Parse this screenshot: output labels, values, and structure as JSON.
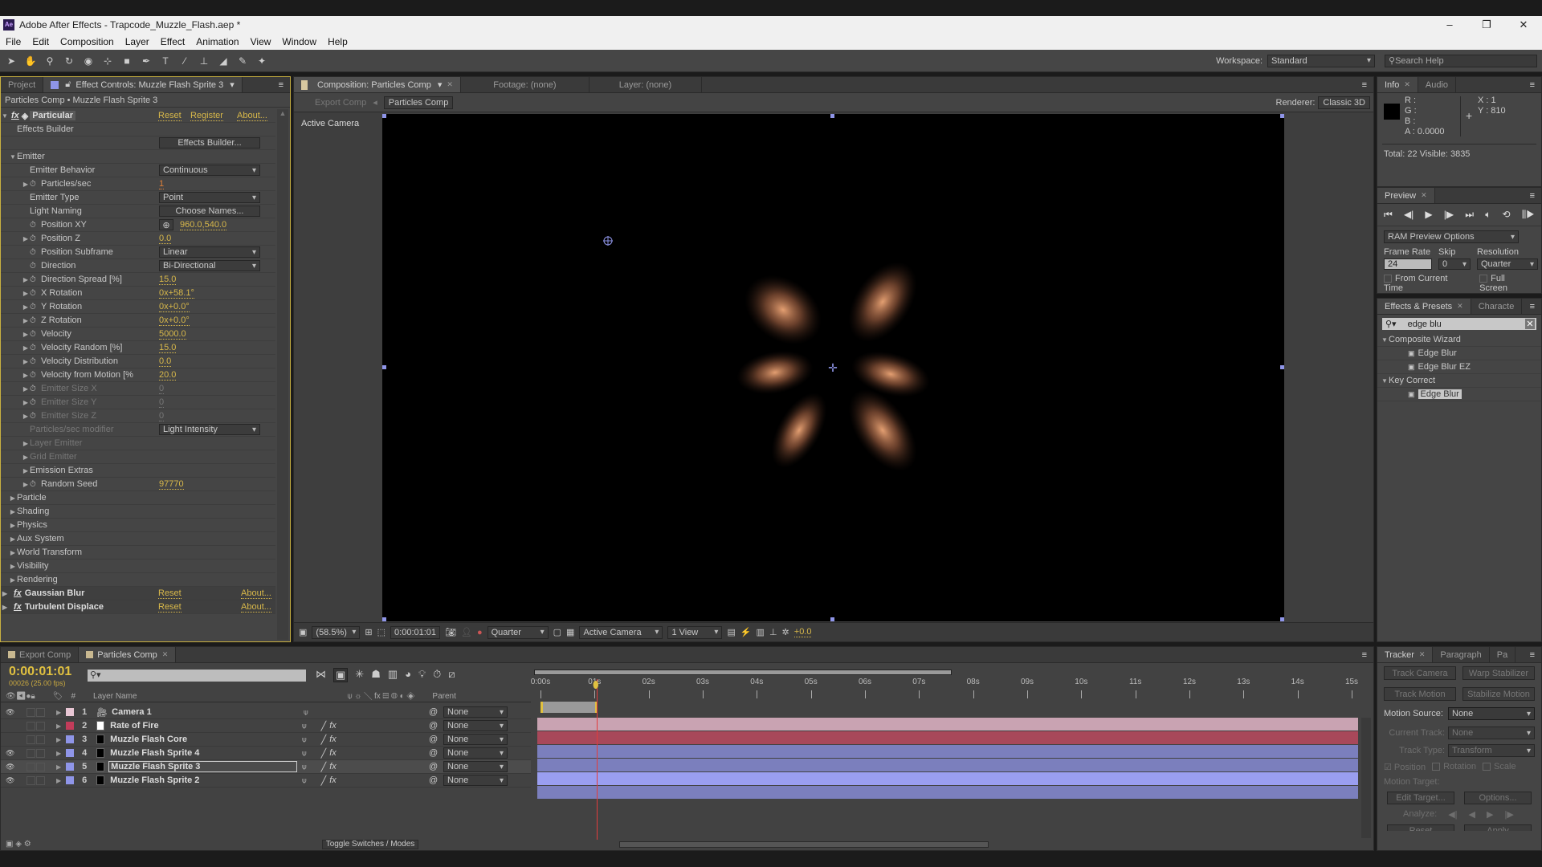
{
  "window": {
    "title": "Adobe After Effects - Trapcode_Muzzle_Flash.aep *",
    "min": "–",
    "max": "❐",
    "close": "✕"
  },
  "menu": [
    "File",
    "Edit",
    "Composition",
    "Layer",
    "Effect",
    "Animation",
    "View",
    "Window",
    "Help"
  ],
  "toolbar": {
    "workspace_label": "Workspace:",
    "workspace": "Standard",
    "search_placeholder": "Search Help"
  },
  "left_panel": {
    "tabs": [
      "Project",
      "Effect Controls: Muzzle Flash Sprite 3"
    ],
    "breadcrumb": "Particles Comp • Muzzle Flash Sprite 3",
    "effect": {
      "name": "Particular",
      "reset": "Reset",
      "register": "Register",
      "about": "About..."
    },
    "rows": [
      {
        "label": "Effects Builder",
        "indent": 1
      },
      {
        "label": "",
        "button": "Effects Builder...",
        "indent": 1
      },
      {
        "label": "Emitter",
        "indent": 1,
        "tri": "open"
      },
      {
        "label": "Emitter Behavior",
        "indent": 2,
        "dropdown": "Continuous"
      },
      {
        "label": "Particles/sec",
        "indent": 2,
        "tri": "closed",
        "sw": true,
        "value": "1",
        "orange": true
      },
      {
        "label": "Emitter Type",
        "indent": 2,
        "dropdown": "Point"
      },
      {
        "label": "Light Naming",
        "indent": 2,
        "button": "Choose Names..."
      },
      {
        "label": "Position XY",
        "indent": 2,
        "sw": true,
        "value": "960.0,540.0",
        "target": true
      },
      {
        "label": "Position Z",
        "indent": 2,
        "tri": "closed",
        "sw": true,
        "value": "0.0"
      },
      {
        "label": "Position Subframe",
        "indent": 2,
        "sw": true,
        "dropdown": "Linear"
      },
      {
        "label": "Direction",
        "indent": 2,
        "sw": true,
        "dropdown": "Bi-Directional"
      },
      {
        "label": "Direction Spread [%]",
        "indent": 2,
        "tri": "closed",
        "sw": true,
        "value": "15.0"
      },
      {
        "label": "X Rotation",
        "indent": 2,
        "tri": "closed",
        "sw": true,
        "value": "0x+58.1°"
      },
      {
        "label": "Y Rotation",
        "indent": 2,
        "tri": "closed",
        "sw": true,
        "value": "0x+0.0°"
      },
      {
        "label": "Z Rotation",
        "indent": 2,
        "tri": "closed",
        "sw": true,
        "value": "0x+0.0°"
      },
      {
        "label": "Velocity",
        "indent": 2,
        "tri": "closed",
        "sw": true,
        "value": "5000.0"
      },
      {
        "label": "Velocity Random [%]",
        "indent": 2,
        "tri": "closed",
        "sw": true,
        "value": "15.0"
      },
      {
        "label": "Velocity Distribution",
        "indent": 2,
        "tri": "closed",
        "sw": true,
        "value": "0.0"
      },
      {
        "label": "Velocity from Motion [%",
        "indent": 2,
        "tri": "closed",
        "sw": true,
        "value": "20.0"
      },
      {
        "label": "Emitter Size X",
        "indent": 2,
        "tri": "closed",
        "sw": true,
        "value": "0",
        "disabled": true
      },
      {
        "label": "Emitter Size Y",
        "indent": 2,
        "tri": "closed",
        "sw": true,
        "value": "0",
        "disabled": true
      },
      {
        "label": "Emitter Size Z",
        "indent": 2,
        "tri": "closed",
        "sw": true,
        "value": "0",
        "disabled": true
      },
      {
        "label": "Particles/sec modifier",
        "indent": 2,
        "dropdown": "Light Intensity",
        "disabled": true
      },
      {
        "label": "Layer Emitter",
        "indent": 2,
        "tri": "closed",
        "disabled": true
      },
      {
        "label": "Grid Emitter",
        "indent": 2,
        "tri": "closed",
        "disabled": true
      },
      {
        "label": "Emission Extras",
        "indent": 2,
        "tri": "closed"
      },
      {
        "label": "Random Seed",
        "indent": 2,
        "tri": "closed",
        "sw": true,
        "value": "97770"
      },
      {
        "label": "Particle",
        "indent": 1,
        "tri": "closed"
      },
      {
        "label": "Shading",
        "indent": 1,
        "tri": "closed"
      },
      {
        "label": "Physics",
        "indent": 1,
        "tri": "closed"
      },
      {
        "label": "Aux System",
        "indent": 1,
        "tri": "closed"
      },
      {
        "label": "World Transform",
        "indent": 1,
        "tri": "closed"
      },
      {
        "label": "Visibility",
        "indent": 1,
        "tri": "closed"
      },
      {
        "label": "Rendering",
        "indent": 1,
        "tri": "closed"
      }
    ],
    "other_effects": [
      {
        "name": "Gaussian Blur",
        "reset": "Reset",
        "about": "About..."
      },
      {
        "name": "Turbulent Displace",
        "reset": "Reset",
        "about": "About..."
      }
    ]
  },
  "viewer": {
    "tabs": [
      "Composition: Particles Comp",
      "Footage: (none)",
      "Layer: (none)"
    ],
    "crumbs": [
      "Export Comp",
      "Particles Comp"
    ],
    "renderer_label": "Renderer:",
    "renderer": "Classic 3D",
    "camera_label": "Active Camera",
    "bottom": {
      "zoom": "(58.5%)",
      "time": "0:00:01:01",
      "resolution": "Quarter",
      "view": "Active Camera",
      "layout": "1 View",
      "exposure": "+0.0"
    }
  },
  "info": {
    "tabs": [
      "Info",
      "Audio"
    ],
    "r": "R :",
    "g": "G :",
    "b": "B :",
    "a": "A : 0.0000",
    "x": "X : 1",
    "y": "Y : 810",
    "totals": "Total: 22   Visible: 3835"
  },
  "preview": {
    "tab": "Preview",
    "ram": "RAM Preview Options",
    "frame_rate_label": "Frame Rate",
    "skip_label": "Skip",
    "resolution_label": "Resolution",
    "frame_rate": "24",
    "skip": "0",
    "resolution": "Quarter",
    "from_current": "From Current Time",
    "full_screen": "Full Screen"
  },
  "effects_presets": {
    "tabs": [
      "Effects & Presets",
      "Characte"
    ],
    "search": "edge blu",
    "groups": [
      {
        "name": "Composite Wizard",
        "items": [
          "Edge Blur",
          "Edge Blur EZ"
        ]
      },
      {
        "name": "Key Correct",
        "items": [
          "Edge Blur"
        ]
      }
    ]
  },
  "timeline": {
    "tabs": [
      "Export Comp",
      "Particles Comp"
    ],
    "timecode": "0:00:01:01",
    "frames": "00026 (25.00 fps)",
    "headers": {
      "num": "#",
      "name": "Layer Name",
      "parent": "Parent"
    },
    "ruler": [
      "0:00s",
      "01s",
      "02s",
      "03s",
      "04s",
      "05s",
      "06s",
      "07s",
      "08s",
      "09s",
      "10s",
      "11s",
      "12s",
      "13s",
      "14s",
      "15s"
    ],
    "playhead_seconds": 1.04,
    "work_area_end_seconds": 7.6,
    "layers": [
      {
        "num": "1",
        "name": "Camera 1",
        "label_color": "#e8c6d4",
        "bar_color": "#c9a3b2",
        "visible": true,
        "camera": true,
        "parent": "None"
      },
      {
        "num": "2",
        "name": "Rate of Fire",
        "label_color": "#c23c5a",
        "bar_color": "#a8485a",
        "visible": false,
        "swatch": "#ffffff",
        "parent": "None"
      },
      {
        "num": "3",
        "name": "Muzzle Flash Core",
        "label_color": "#8f95e8",
        "bar_color": "#7b7fbd",
        "visible": false,
        "swatch": "#000000",
        "parent": "None"
      },
      {
        "num": "4",
        "name": "Muzzle Flash Sprite 4",
        "label_color": "#8f95e8",
        "bar_color": "#7b7fbd",
        "visible": true,
        "swatch": "#000000",
        "parent": "None"
      },
      {
        "num": "5",
        "name": "Muzzle Flash Sprite 3",
        "label_color": "#8f95e8",
        "bar_color": "#9a9ef0",
        "visible": true,
        "swatch": "#000000",
        "parent": "None",
        "selected": true
      },
      {
        "num": "6",
        "name": "Muzzle Flash Sprite 2",
        "label_color": "#8f95e8",
        "bar_color": "#7b7fbd",
        "visible": true,
        "swatch": "#000000",
        "parent": "None"
      }
    ],
    "toggle": "Toggle Switches / Modes"
  },
  "tracker": {
    "tabs": [
      "Tracker",
      "Paragraph",
      "Pa"
    ],
    "track_camera": "Track Camera",
    "warp": "Warp Stabilizer",
    "track_motion": "Track Motion",
    "stabilize": "Stabilize Motion",
    "motion_source_label": "Motion Source:",
    "motion_source": "None",
    "current_track_label": "Current Track:",
    "current_track": "None",
    "track_type_label": "Track Type:",
    "track_type": "Transform",
    "position": "Position",
    "rotation": "Rotation",
    "scale": "Scale",
    "motion_target": "Motion Target:",
    "edit_target": "Edit Target...",
    "options": "Options...",
    "analyze": "Analyze:",
    "reset": "Reset",
    "apply": "Apply"
  },
  "colors": {
    "accent": "#d8b84a",
    "panel": "#454545",
    "selection_handle": "#8f95e8",
    "playhead": "#e23c3c"
  }
}
